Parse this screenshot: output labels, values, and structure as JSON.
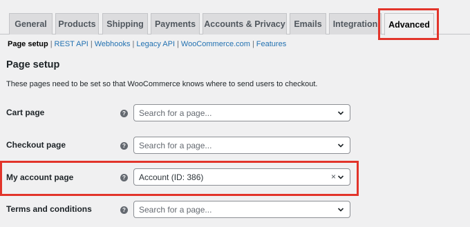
{
  "tabs": [
    {
      "label": "General"
    },
    {
      "label": "Products"
    },
    {
      "label": "Shipping"
    },
    {
      "label": "Payments"
    },
    {
      "label": "Accounts & Privacy"
    },
    {
      "label": "Emails"
    },
    {
      "label": "Integration"
    },
    {
      "label": "Advanced",
      "active": true
    }
  ],
  "subnav": [
    {
      "label": "Page setup",
      "current": true
    },
    {
      "label": "REST API"
    },
    {
      "label": "Webhooks"
    },
    {
      "label": "Legacy API"
    },
    {
      "label": "WooCommerce.com"
    },
    {
      "label": "Features"
    }
  ],
  "subnav_separator": "|",
  "section": {
    "title": "Page setup",
    "description": "These pages need to be set so that WooCommerce knows where to send users to checkout."
  },
  "rows": [
    {
      "label": "Cart page",
      "placeholder": "Search for a page...",
      "value": ""
    },
    {
      "label": "Checkout page",
      "placeholder": "Search for a page...",
      "value": ""
    },
    {
      "label": "My account page",
      "placeholder": "",
      "value": "Account (ID: 386)",
      "clear": "×"
    },
    {
      "label": "Terms and conditions",
      "placeholder": "Search for a page...",
      "value": ""
    }
  ],
  "help_icon_glyph": "?",
  "colors": {
    "highlight": "#e2342a",
    "link": "#2271b1",
    "background": "#f0f0f1"
  }
}
